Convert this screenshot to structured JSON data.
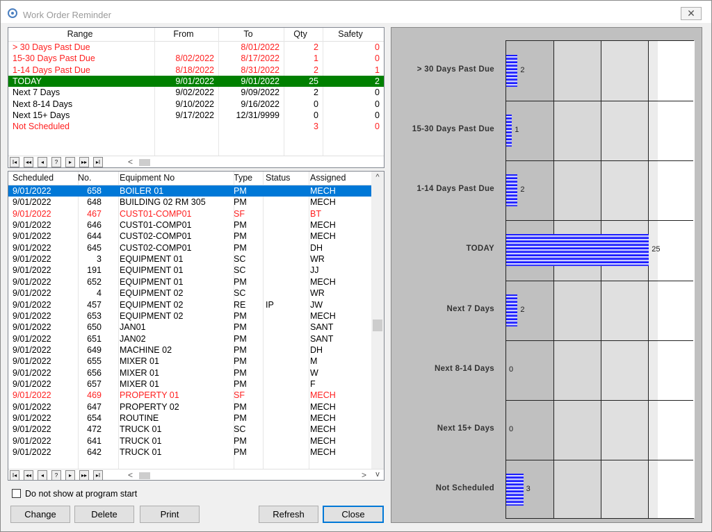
{
  "window": {
    "title": "Work Order Reminder",
    "close_label": "✕"
  },
  "ranges": {
    "columns": [
      "Range",
      "From",
      "To",
      "Qty",
      "Safety"
    ],
    "rows": [
      {
        "range": "> 30 Days Past Due",
        "from": "",
        "to": "8/01/2022",
        "qty": "2",
        "safety": "0",
        "style": "red"
      },
      {
        "range": "15-30 Days Past Due",
        "from": "8/02/2022",
        "to": "8/17/2022",
        "qty": "1",
        "safety": "0",
        "style": "red"
      },
      {
        "range": "1-14 Days Past Due",
        "from": "8/18/2022",
        "to": "8/31/2022",
        "qty": "2",
        "safety": "1",
        "style": "red"
      },
      {
        "range": "TODAY",
        "from": "9/01/2022",
        "to": "9/01/2022",
        "qty": "25",
        "safety": "2",
        "style": "green"
      },
      {
        "range": "Next 7 Days",
        "from": "9/02/2022",
        "to": "9/09/2022",
        "qty": "2",
        "safety": "0",
        "style": "normal"
      },
      {
        "range": "Next 8-14 Days",
        "from": "9/10/2022",
        "to": "9/16/2022",
        "qty": "0",
        "safety": "0",
        "style": "normal"
      },
      {
        "range": "Next 15+ Days",
        "from": "9/17/2022",
        "to": "12/31/9999",
        "qty": "0",
        "safety": "0",
        "style": "normal"
      },
      {
        "range": "Not Scheduled",
        "from": "",
        "to": "",
        "qty": "3",
        "safety": "0",
        "style": "red"
      }
    ]
  },
  "orders": {
    "columns": [
      "Scheduled",
      "No.",
      "Equipment No",
      "Type",
      "Status",
      "Assigned"
    ],
    "rows": [
      {
        "scheduled": "9/01/2022",
        "no": "658",
        "equipment": "BOILER 01",
        "type": "PM",
        "status": "",
        "assigned": "MECH",
        "style": "selected"
      },
      {
        "scheduled": "9/01/2022",
        "no": "648",
        "equipment": "BUILDING 02 RM 305",
        "type": "PM",
        "status": "",
        "assigned": "MECH",
        "style": "normal"
      },
      {
        "scheduled": "9/01/2022",
        "no": "467",
        "equipment": "CUST01-COMP01",
        "type": "SF",
        "status": "",
        "assigned": "BT",
        "style": "red"
      },
      {
        "scheduled": "9/01/2022",
        "no": "646",
        "equipment": "CUST01-COMP01",
        "type": "PM",
        "status": "",
        "assigned": "MECH",
        "style": "normal"
      },
      {
        "scheduled": "9/01/2022",
        "no": "644",
        "equipment": "CUST02-COMP01",
        "type": "PM",
        "status": "",
        "assigned": "MECH",
        "style": "normal"
      },
      {
        "scheduled": "9/01/2022",
        "no": "645",
        "equipment": "CUST02-COMP01",
        "type": "PM",
        "status": "",
        "assigned": "DH",
        "style": "normal"
      },
      {
        "scheduled": "9/01/2022",
        "no": "3",
        "equipment": "EQUIPMENT 01",
        "type": "SC",
        "status": "",
        "assigned": "WR",
        "style": "normal"
      },
      {
        "scheduled": "9/01/2022",
        "no": "191",
        "equipment": "EQUIPMENT 01",
        "type": "SC",
        "status": "",
        "assigned": "JJ",
        "style": "normal"
      },
      {
        "scheduled": "9/01/2022",
        "no": "652",
        "equipment": "EQUIPMENT 01",
        "type": "PM",
        "status": "",
        "assigned": "MECH",
        "style": "normal"
      },
      {
        "scheduled": "9/01/2022",
        "no": "4",
        "equipment": "EQUIPMENT 02",
        "type": "SC",
        "status": "",
        "assigned": "WR",
        "style": "normal"
      },
      {
        "scheduled": "9/01/2022",
        "no": "457",
        "equipment": "EQUIPMENT 02",
        "type": "RE",
        "status": "IP",
        "assigned": "JW",
        "style": "normal"
      },
      {
        "scheduled": "9/01/2022",
        "no": "653",
        "equipment": "EQUIPMENT 02",
        "type": "PM",
        "status": "",
        "assigned": "MECH",
        "style": "normal"
      },
      {
        "scheduled": "9/01/2022",
        "no": "650",
        "equipment": "JAN01",
        "type": "PM",
        "status": "",
        "assigned": "SANT",
        "style": "normal"
      },
      {
        "scheduled": "9/01/2022",
        "no": "651",
        "equipment": "JAN02",
        "type": "PM",
        "status": "",
        "assigned": "SANT",
        "style": "normal"
      },
      {
        "scheduled": "9/01/2022",
        "no": "649",
        "equipment": "MACHINE 02",
        "type": "PM",
        "status": "",
        "assigned": "DH",
        "style": "normal"
      },
      {
        "scheduled": "9/01/2022",
        "no": "655",
        "equipment": "MIXER 01",
        "type": "PM",
        "status": "",
        "assigned": "M",
        "style": "normal"
      },
      {
        "scheduled": "9/01/2022",
        "no": "656",
        "equipment": "MIXER 01",
        "type": "PM",
        "status": "",
        "assigned": "W",
        "style": "normal"
      },
      {
        "scheduled": "9/01/2022",
        "no": "657",
        "equipment": "MIXER 01",
        "type": "PM",
        "status": "",
        "assigned": "F",
        "style": "normal"
      },
      {
        "scheduled": "9/01/2022",
        "no": "469",
        "equipment": "PROPERTY 01",
        "type": "SF",
        "status": "",
        "assigned": "MECH",
        "style": "red"
      },
      {
        "scheduled": "9/01/2022",
        "no": "647",
        "equipment": "PROPERTY 02",
        "type": "PM",
        "status": "",
        "assigned": "MECH",
        "style": "normal"
      },
      {
        "scheduled": "9/01/2022",
        "no": "654",
        "equipment": "ROUTINE",
        "type": "PM",
        "status": "",
        "assigned": "MECH",
        "style": "normal"
      },
      {
        "scheduled": "9/01/2022",
        "no": "472",
        "equipment": "TRUCK 01",
        "type": "SC",
        "status": "",
        "assigned": "MECH",
        "style": "normal"
      },
      {
        "scheduled": "9/01/2022",
        "no": "641",
        "equipment": "TRUCK 01",
        "type": "PM",
        "status": "",
        "assigned": "MECH",
        "style": "normal"
      },
      {
        "scheduled": "9/01/2022",
        "no": "642",
        "equipment": "TRUCK 01",
        "type": "PM",
        "status": "",
        "assigned": "MECH",
        "style": "normal"
      }
    ]
  },
  "navigator": {
    "first": "I◂",
    "prev_page": "◂◂",
    "prev": "◂",
    "help": "?",
    "next": "▸",
    "next_page": "▸▸",
    "last": "▸I",
    "scroll_left": "<",
    "scroll_right": ">",
    "scroll_down": "v",
    "scroll_up": "^"
  },
  "checkbox": {
    "label": "Do not show at program start",
    "checked": false
  },
  "buttons": {
    "change": "Change",
    "delete": "Delete",
    "print": "Print",
    "refresh": "Refresh",
    "close": "Close"
  },
  "colors": {
    "red": "#ff2020",
    "green": "#008000",
    "selected": "#0078d7",
    "bar": "#1a1aff"
  },
  "chart_data": {
    "type": "bar",
    "orientation": "horizontal",
    "categories": [
      "> 30 Days Past Due",
      "15-30 Days Past Due",
      "1-14 Days Past Due",
      "TODAY",
      "Next 7 Days",
      "Next 8-14 Days",
      "Next 15+ Days",
      "Not Scheduled"
    ],
    "values": [
      2,
      1,
      2,
      25,
      2,
      0,
      0,
      3
    ],
    "data_labels": [
      "2",
      "1",
      "2",
      "25",
      "2",
      "0",
      "0",
      "3"
    ],
    "xlim": [
      0,
      33
    ],
    "grid": true,
    "title": "",
    "xlabel": "",
    "ylabel": ""
  }
}
